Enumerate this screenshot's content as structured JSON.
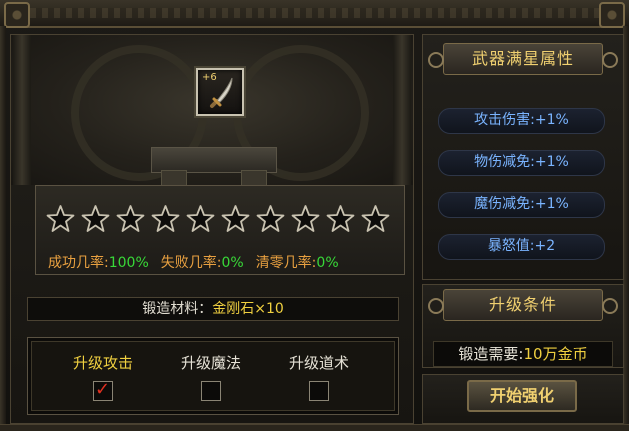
{
  "weapon": {
    "enhance_level": "+6",
    "icon": "curved-sword-icon"
  },
  "stars": {
    "total": 10,
    "filled": 0
  },
  "rates": [
    {
      "label": "成功几率:",
      "value": "100%"
    },
    {
      "label": "失败几率:",
      "value": "0%"
    },
    {
      "label": "清零几率:",
      "value": "0%"
    }
  ],
  "material": {
    "label": "锻造材料：",
    "value": "金刚石×10"
  },
  "upgrade_options": [
    {
      "label": "升级攻击",
      "checked": true
    },
    {
      "label": "升级魔法",
      "checked": false
    },
    {
      "label": "升级道术",
      "checked": false
    }
  ],
  "max_star": {
    "title": "武器满星属性",
    "attributes": [
      {
        "label": "攻击伤害:",
        "value": "+1%"
      },
      {
        "label": "物伤减免:",
        "value": "+1%"
      },
      {
        "label": "魔伤减免:",
        "value": "+1%"
      },
      {
        "label": "暴怒值:",
        "value": "+2"
      }
    ]
  },
  "upgrade_condition": {
    "title": "升级条件",
    "cost_label": "锻造需要:",
    "cost_value": "10万金币"
  },
  "start_button": {
    "label": "开始强化"
  },
  "colors": {
    "gold": "#f0d040",
    "green": "#38d838",
    "orange": "#e8a040",
    "blue": "#7ab4ff",
    "check": "#e03020"
  }
}
